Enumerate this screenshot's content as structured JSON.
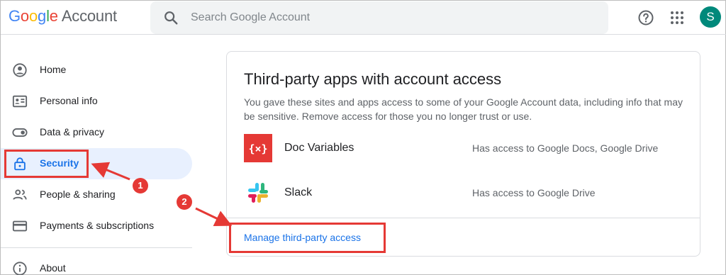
{
  "header": {
    "logo_letters": [
      "G",
      "o",
      "o",
      "g",
      "l",
      "e"
    ],
    "logo_suffix": "Account",
    "search_placeholder": "Search Google Account",
    "avatar_initial": "S",
    "avatar_color": "#00897b"
  },
  "sidebar": {
    "items": [
      {
        "label": "Home",
        "icon": "account-circle-icon"
      },
      {
        "label": "Personal info",
        "icon": "badge-icon"
      },
      {
        "label": "Data & privacy",
        "icon": "toggle-icon"
      },
      {
        "label": "Security",
        "icon": "lock-icon",
        "active": true
      },
      {
        "label": "People & sharing",
        "icon": "people-icon"
      },
      {
        "label": "Payments & subscriptions",
        "icon": "credit-card-icon"
      },
      {
        "label": "About",
        "icon": "info-icon"
      }
    ]
  },
  "card": {
    "title": "Third-party apps with account access",
    "description": "You gave these sites and apps access to some of your Google Account data, including info that may be sensitive. Remove access for those you no longer trust or use.",
    "apps": [
      {
        "name": "Doc Variables",
        "access": "Has access to Google Docs, Google Drive",
        "icon": "doc-variables-icon"
      },
      {
        "name": "Slack",
        "access": "Has access to Google Drive",
        "icon": "slack-icon"
      }
    ],
    "manage_link": "Manage third-party access"
  },
  "annotations": {
    "step1": "1",
    "step2": "2",
    "highlight_color": "#e53935"
  }
}
